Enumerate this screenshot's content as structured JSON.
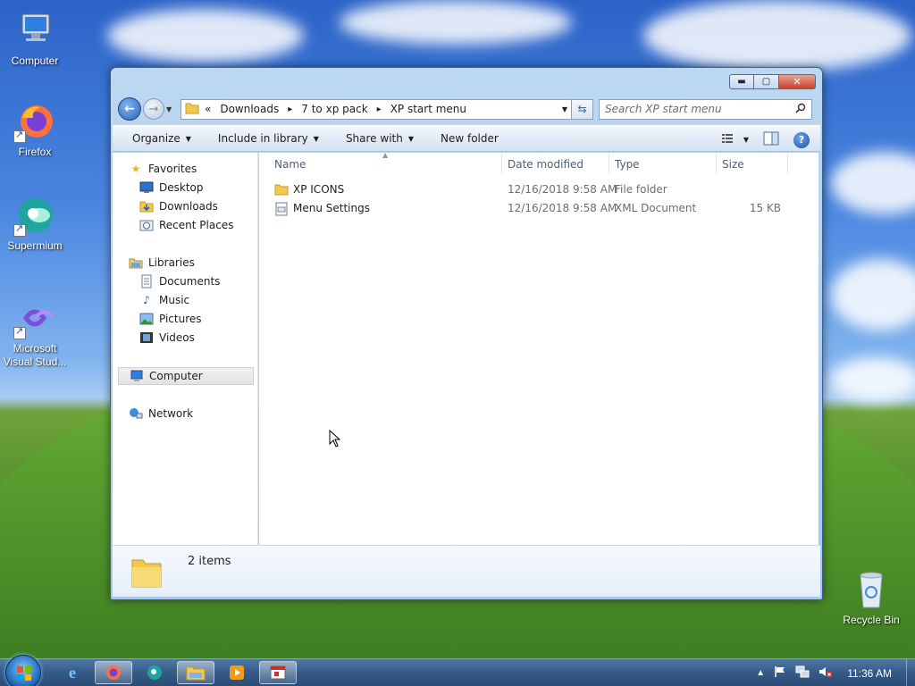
{
  "desktop": {
    "icons": [
      {
        "label": "Computer"
      },
      {
        "label": "Firefox"
      },
      {
        "label": "Supermium"
      },
      {
        "label": "Microsoft Visual Stud..."
      },
      {
        "label": "Recycle Bin"
      }
    ]
  },
  "window": {
    "controls": {
      "minimize": "▬",
      "maximize": "▢",
      "close": "✕"
    },
    "address": {
      "overflow": "«",
      "segments": [
        "Downloads",
        "7 to xp pack",
        "XP start menu"
      ],
      "separator": "▸"
    },
    "search": {
      "placeholder": "Search XP start menu"
    },
    "toolbar": {
      "organize": "Organize",
      "include_in_library": "Include in library",
      "share_with": "Share with",
      "new_folder": "New folder"
    },
    "nav_pane": {
      "favorites": "Favorites",
      "desktop": "Desktop",
      "downloads": "Downloads",
      "recent_places": "Recent Places",
      "libraries": "Libraries",
      "documents": "Documents",
      "music": "Music",
      "pictures": "Pictures",
      "videos": "Videos",
      "computer": "Computer",
      "network": "Network",
      "selected": "Computer"
    },
    "columns": {
      "name": "Name",
      "date_modified": "Date modified",
      "type": "Type",
      "size": "Size"
    },
    "files": [
      {
        "name": "XP ICONS",
        "date": "12/16/2018 9:58 AM",
        "type": "File folder",
        "size": ""
      },
      {
        "name": "Menu Settings",
        "date": "12/16/2018 9:58 AM",
        "type": "XML Document",
        "size": "15 KB"
      }
    ],
    "details": {
      "item_count": "2 items"
    }
  },
  "taskbar": {
    "clock": "11:36 AM",
    "active_app": "Windows Explorer"
  },
  "colors": {
    "accent": "#2a62b4",
    "titlebar": "#bcd8f1",
    "close_button": "#c8432a",
    "taskbar": "#355a86"
  }
}
